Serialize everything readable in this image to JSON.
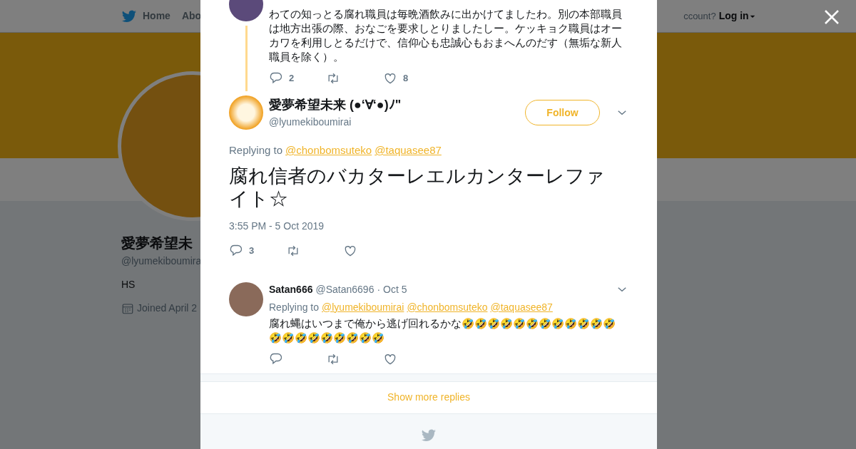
{
  "background_page": {
    "nav": {
      "items": [
        {
          "label": "Home"
        },
        {
          "label": "Abo"
        }
      ],
      "account_prompt": "ccount?",
      "login": "Log in"
    },
    "profile": {
      "name": "愛夢希望未",
      "handle": "@lyumekiboumira",
      "bio": "HS",
      "joined": "Joined April 2"
    }
  },
  "modal": {
    "parent_tweet": {
      "text": "わての知っとる腐れ職員は毎晩酒飲みに出かけてましたわ。別の本部職員は地方出張の際、おなごを要求しとりましたしー。ケッキョク職員はオーカワを利用しとるだけで、信仰心も忠誠心もおまへんのだす（無垢な新人職員を除く）。",
      "reply_count": "2",
      "like_count": "8"
    },
    "tweet": {
      "name": "愛夢希望未来 (●‘∀‘●)ﾉ\"",
      "handle": "@lyumekiboumirai",
      "follow_label": "Follow",
      "replying_prefix": "Replying to",
      "mentions": [
        "@chonbomsuteko",
        "@taquasee87"
      ],
      "text": "腐れ信者のバカターレエルカンターレファイト☆",
      "timestamp": "3:55 PM - 5 Oct 2019",
      "reply_count": "3"
    },
    "replies": [
      {
        "name": "Satan666",
        "handle": "@Satan6696",
        "separator": "·",
        "date": "Oct 5",
        "replying_prefix": "Replying to",
        "mentions": [
          "@lyumekiboumirai",
          "@chonbomsuteko",
          "@taquasee87"
        ],
        "text": "腐れ蝿はいつまで俺から逃げ回れるかな🤣🤣🤣🤣🤣🤣🤣🤣🤣🤣🤣🤣🤣🤣🤣🤣🤣🤣🤣🤣🤣"
      }
    ],
    "show_more": "Show more replies"
  }
}
